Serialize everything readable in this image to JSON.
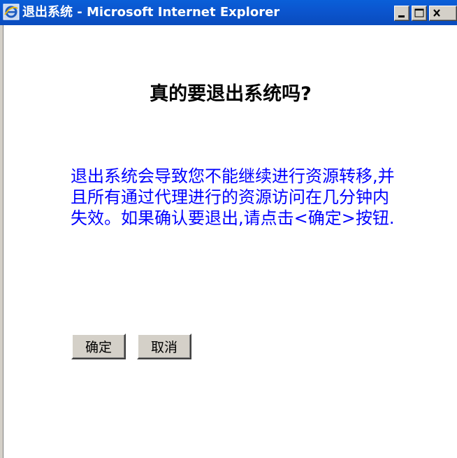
{
  "window": {
    "title": "退出系统 - Microsoft Internet Explorer",
    "app_icon": "internet-explorer-icon",
    "title_bar_color": "#0a56cf"
  },
  "dialog": {
    "heading": "真的要退出系统吗?",
    "message": "退出系统会导致您不能继续进行资源转移,并且所有通过代理进行的资源访问在几分钟内失效。如果确认要退出,请点击<确定>按钮.",
    "message_color": "#0000ff"
  },
  "buttons": {
    "ok_label": "确定",
    "cancel_label": "取消"
  }
}
